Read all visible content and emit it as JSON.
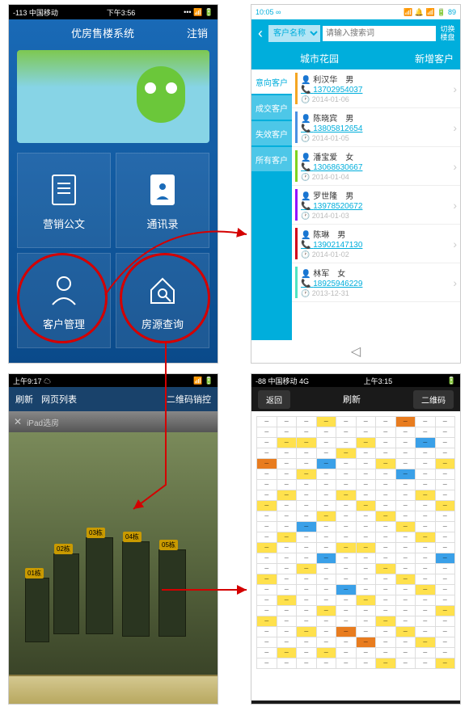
{
  "screen1": {
    "status": {
      "left": "-113 中国移动",
      "center": "下午3:56",
      "right": "••• 📶 🔋"
    },
    "header": {
      "title": "优房售楼系统",
      "logout": "注销"
    },
    "tiles": [
      {
        "label": "营销公文",
        "icon": "document"
      },
      {
        "label": "通讯录",
        "icon": "contacts"
      },
      {
        "label": "客户管理",
        "icon": "customer"
      },
      {
        "label": "房源查询",
        "icon": "house-search"
      }
    ]
  },
  "screen2": {
    "status": {
      "left": "10:05 ∞",
      "right": "📶 🔔 📶 🔋 89"
    },
    "search": {
      "dropdown": "客户名称",
      "placeholder": "请输入搜索词",
      "switch": "切换楼盘"
    },
    "titlebar": {
      "title": "城市花园",
      "add": "新增客户"
    },
    "sidebar": [
      "意向客户",
      "成交客户",
      "失效客户",
      "所有客户"
    ],
    "active_tab": 0,
    "customers": [
      {
        "name": "利汉华",
        "gender": "男",
        "phone": "13702954037",
        "date": "2014-01-06",
        "color": "#f5a623"
      },
      {
        "name": "陈晓宾",
        "gender": "男",
        "phone": "13805812654",
        "date": "2014-01-05",
        "color": "#4a90e2"
      },
      {
        "name": "潘宝爱",
        "gender": "女",
        "phone": "13068630667",
        "date": "2014-01-04",
        "color": "#7ed321"
      },
      {
        "name": "罗世隆",
        "gender": "男",
        "phone": "13978520672",
        "date": "2014-01-03",
        "color": "#9013fe"
      },
      {
        "name": "陈琳",
        "gender": "男",
        "phone": "13902147130",
        "date": "2014-01-02",
        "color": "#d0021b"
      },
      {
        "name": "林军",
        "gender": "女",
        "phone": "18925946229",
        "date": "2013-12-31",
        "color": "#50e3c2"
      }
    ]
  },
  "screen3": {
    "status": {
      "left": "上午9:17 ☁",
      "right": "📶 🔋"
    },
    "header": {
      "refresh": "刷新",
      "weblist": "网页列表",
      "qr": "二维码销控"
    },
    "subbar": {
      "close": "✕",
      "text": "iPad选房"
    },
    "buildings": [
      "01栋",
      "02栋",
      "03栋",
      "04栋",
      "05栋"
    ]
  },
  "screen4": {
    "status": {
      "left": "-88 中国移动 4G",
      "center": "上午3:15",
      "right": "🔋"
    },
    "header": {
      "back": "返回",
      "refresh": "刷新",
      "qr": "二维码"
    },
    "cell_colors": {
      "avail": "#ffffff",
      "sold": "#3aa0e8",
      "hold": "#ffe14d",
      "spec": "#e87c1f"
    },
    "grid_rows": 24,
    "grid_cols": 10,
    "colored_cells": [
      [
        0,
        3,
        "hold"
      ],
      [
        0,
        7,
        "spec"
      ],
      [
        2,
        1,
        "hold"
      ],
      [
        2,
        2,
        "hold"
      ],
      [
        2,
        5,
        "hold"
      ],
      [
        2,
        8,
        "sold"
      ],
      [
        3,
        4,
        "hold"
      ],
      [
        4,
        0,
        "spec"
      ],
      [
        4,
        3,
        "sold"
      ],
      [
        4,
        6,
        "hold"
      ],
      [
        4,
        9,
        "hold"
      ],
      [
        5,
        2,
        "hold"
      ],
      [
        5,
        7,
        "sold"
      ],
      [
        7,
        1,
        "hold"
      ],
      [
        7,
        4,
        "hold"
      ],
      [
        7,
        8,
        "hold"
      ],
      [
        8,
        0,
        "hold"
      ],
      [
        8,
        5,
        "hold"
      ],
      [
        8,
        9,
        "hold"
      ],
      [
        9,
        3,
        "hold"
      ],
      [
        9,
        6,
        "hold"
      ],
      [
        10,
        2,
        "sold"
      ],
      [
        10,
        7,
        "hold"
      ],
      [
        11,
        1,
        "hold"
      ],
      [
        11,
        8,
        "hold"
      ],
      [
        12,
        0,
        "hold"
      ],
      [
        12,
        4,
        "hold"
      ],
      [
        12,
        5,
        "hold"
      ],
      [
        13,
        3,
        "sold"
      ],
      [
        13,
        9,
        "sold"
      ],
      [
        14,
        2,
        "hold"
      ],
      [
        14,
        6,
        "hold"
      ],
      [
        15,
        0,
        "hold"
      ],
      [
        15,
        7,
        "hold"
      ],
      [
        16,
        4,
        "sold"
      ],
      [
        16,
        8,
        "hold"
      ],
      [
        17,
        1,
        "hold"
      ],
      [
        17,
        5,
        "hold"
      ],
      [
        18,
        3,
        "hold"
      ],
      [
        18,
        9,
        "hold"
      ],
      [
        19,
        0,
        "hold"
      ],
      [
        19,
        6,
        "hold"
      ],
      [
        20,
        2,
        "hold"
      ],
      [
        20,
        4,
        "spec"
      ],
      [
        20,
        7,
        "hold"
      ],
      [
        21,
        5,
        "spec"
      ],
      [
        21,
        8,
        "hold"
      ],
      [
        22,
        1,
        "hold"
      ],
      [
        22,
        3,
        "hold"
      ],
      [
        23,
        6,
        "hold"
      ],
      [
        23,
        9,
        "hold"
      ]
    ]
  }
}
